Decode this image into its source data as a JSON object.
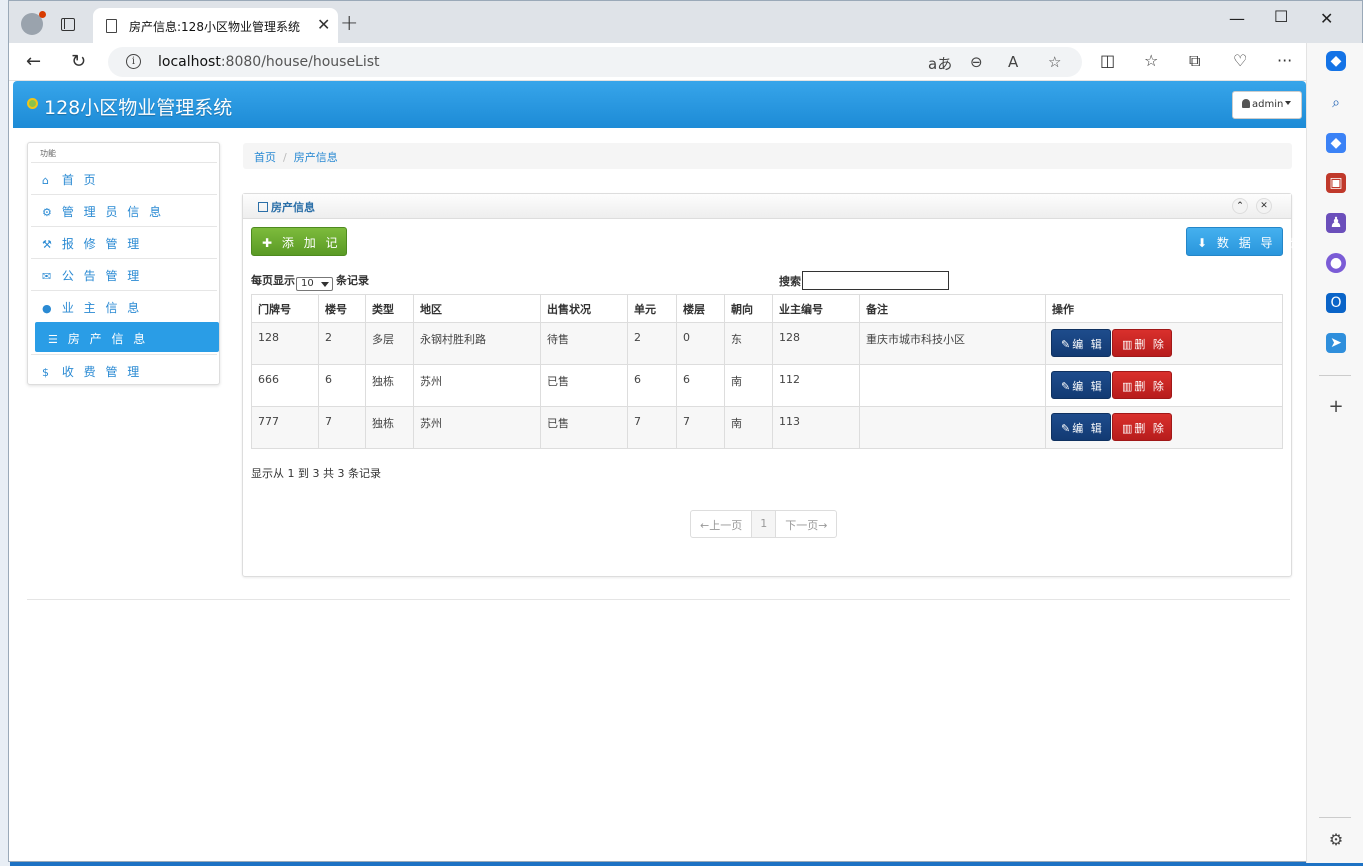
{
  "browser": {
    "tab_title": "房产信息:128小区物业管理系统",
    "url_host": "localhost",
    "url_rest": ":8080/house/houseList"
  },
  "app": {
    "brand": "128小区物业管理系统",
    "user": "admin"
  },
  "menu": {
    "title": "功能",
    "items": [
      {
        "label": "首 页",
        "icon": "home-icon"
      },
      {
        "label": "管 理 员 信 息",
        "icon": "gear-icon"
      },
      {
        "label": "报 修 管 理",
        "icon": "wrench-icon"
      },
      {
        "label": "公 告 管 理",
        "icon": "envelope-icon"
      },
      {
        "label": "业 主 信 息",
        "icon": "user-icon"
      },
      {
        "label": "房 产 信 息",
        "icon": "list-icon"
      },
      {
        "label": "收 费 管 理",
        "icon": "dollar-icon"
      }
    ]
  },
  "breadcrumb": {
    "home": "首页",
    "current": "房产信息"
  },
  "panel": {
    "title": "房产信息",
    "add_label": "添 加 记 录",
    "export_label": "数 据 导 出",
    "length_prefix": "每页显示",
    "length_value": "10",
    "length_suffix": "条记录",
    "search_label": "搜索:",
    "info": "显示从 1 到 3 共 3 条记录",
    "prev": "←上一页",
    "page": "1",
    "next": "下一页→"
  },
  "table": {
    "headers": [
      "门牌号",
      "楼号",
      "类型",
      "地区",
      "出售状况",
      "单元",
      "楼层",
      "朝向",
      "业主编号",
      "备注",
      "操作"
    ],
    "rows": [
      [
        "128",
        "2",
        "多层",
        "永钢村胜利路",
        "待售",
        "2",
        "0",
        "东",
        "128",
        "重庆市城市科技小区"
      ],
      [
        "666",
        "6",
        "独栋",
        "苏州",
        "已售",
        "6",
        "6",
        "南",
        "112",
        ""
      ],
      [
        "777",
        "7",
        "独栋",
        "苏州",
        "已售",
        "7",
        "7",
        "南",
        "113",
        ""
      ]
    ],
    "edit_label": "编 辑",
    "delete_label": "删 除"
  }
}
